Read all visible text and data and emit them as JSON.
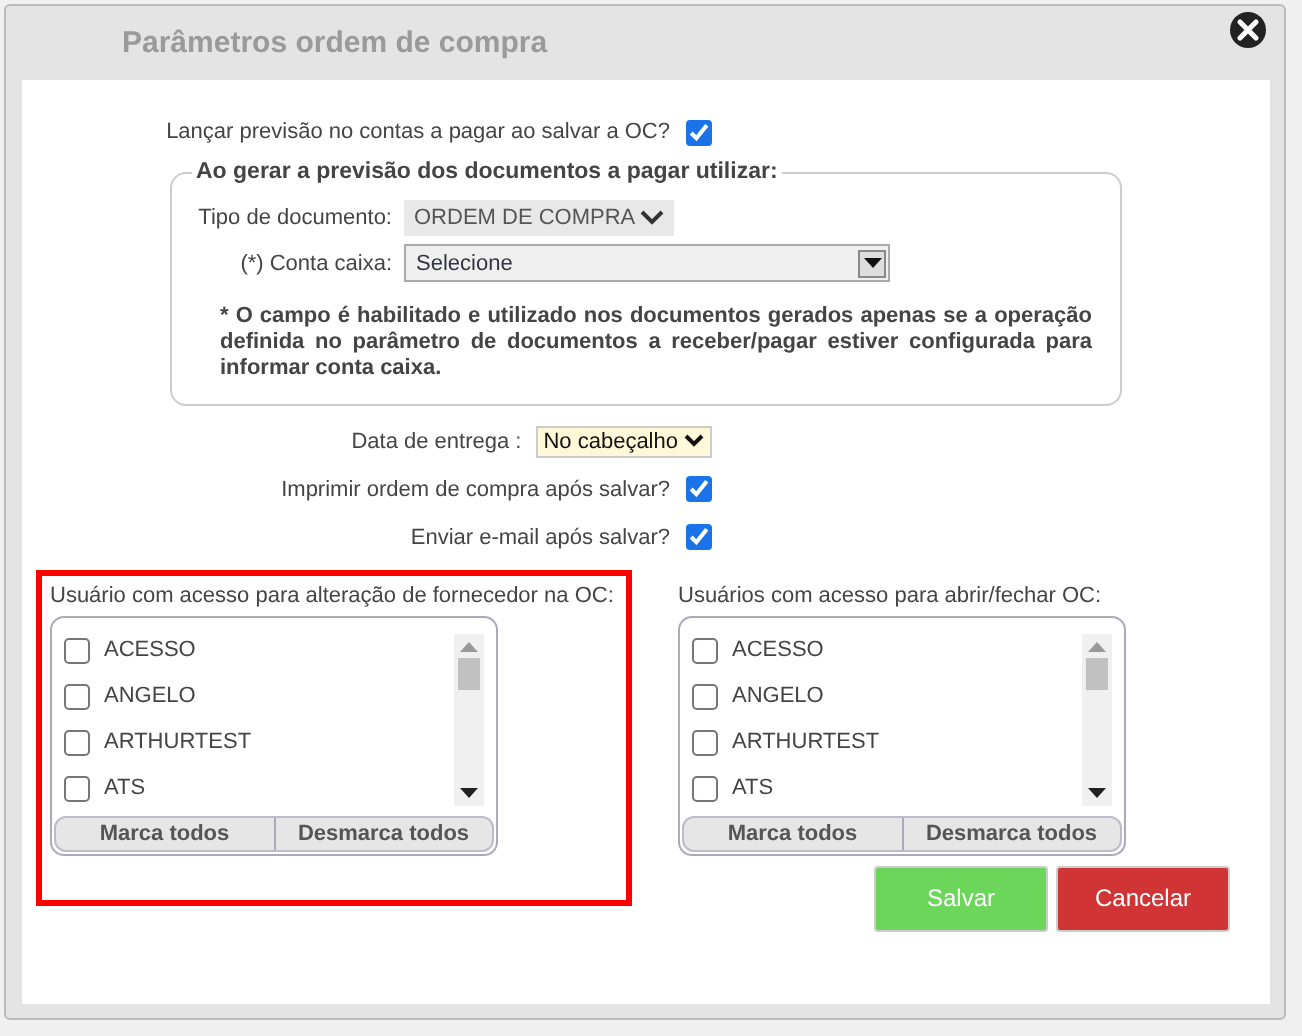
{
  "window": {
    "title": "Parâmetros ordem de compra"
  },
  "launch_forecast": {
    "label": "Lançar previsão no contas a pagar ao salvar a OC?",
    "checked": true
  },
  "fieldset": {
    "legend": "Ao gerar a previsão dos documentos a pagar utilizar:",
    "doc_type": {
      "label": "Tipo de documento:",
      "value": "ORDEM DE COMPRA"
    },
    "account": {
      "label": "(*) Conta caixa:",
      "value": "Selecione"
    },
    "note": "* O campo é habilitado e utilizado nos documentos gerados apenas se a operação definida no parâmetro de documentos a receber/pagar estiver configurada para informar conta caixa."
  },
  "delivery": {
    "label": "Data de entrega :",
    "value": "No cabeçalho"
  },
  "print": {
    "label": "Imprimir ordem de compra após salvar?",
    "checked": true
  },
  "email": {
    "label": "Enviar e-mail após salvar?",
    "checked": true
  },
  "lists": [
    {
      "title": "Usuário com acesso para alteração de fornecedor na OC:",
      "highlighted": true,
      "items": [
        {
          "label": "ACESSO",
          "checked": false
        },
        {
          "label": "ANGELO",
          "checked": false
        },
        {
          "label": "ARTHURTEST",
          "checked": false
        },
        {
          "label": "ATS",
          "checked": false
        }
      ],
      "buttons": [
        "Marca todos",
        "Desmarca todos"
      ]
    },
    {
      "title": "Usuários com acesso para abrir/fechar OC:",
      "highlighted": false,
      "items": [
        {
          "label": "ACESSO",
          "checked": false
        },
        {
          "label": "ANGELO",
          "checked": false
        },
        {
          "label": "ARTHURTEST",
          "checked": false
        },
        {
          "label": "ATS",
          "checked": false
        }
      ],
      "buttons": [
        "Marca todos",
        "Desmarca todos"
      ]
    }
  ],
  "buttons": [
    {
      "label": "Salvar",
      "kind": "primary"
    },
    {
      "label": "Cancelar",
      "kind": "danger"
    }
  ]
}
